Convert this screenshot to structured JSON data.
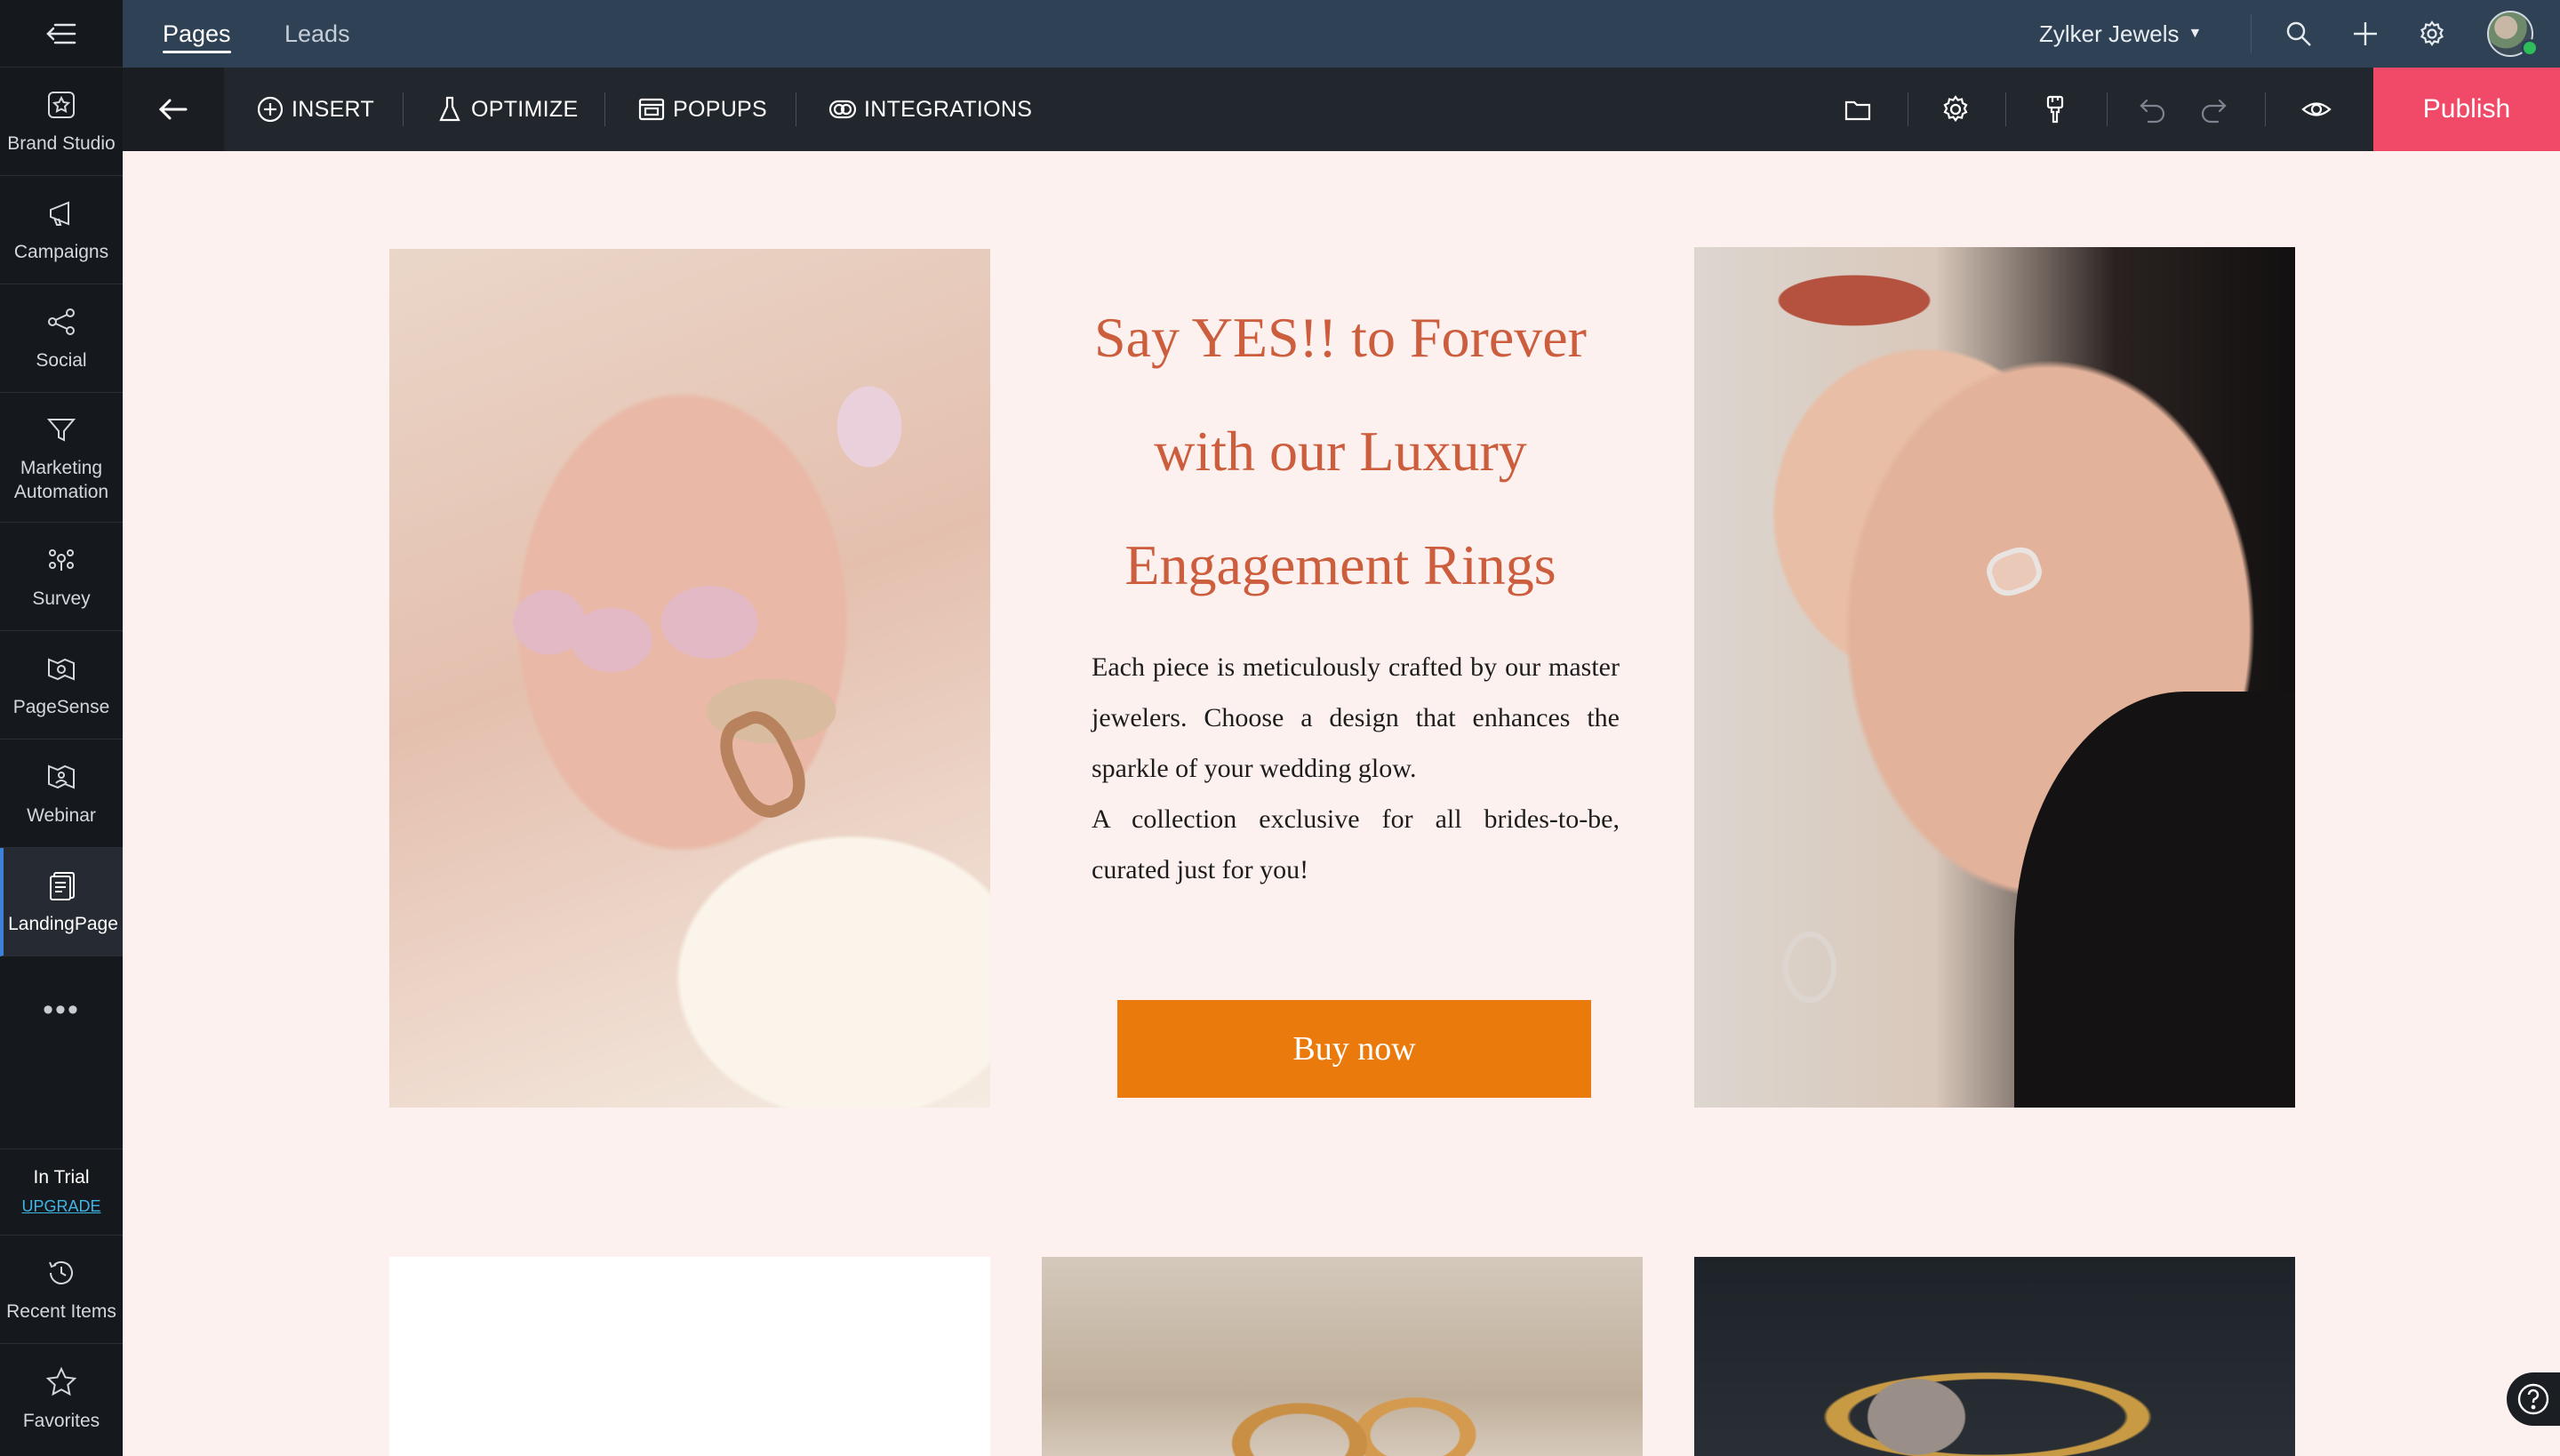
{
  "sidebar": {
    "items": [
      {
        "label": "Brand Studio",
        "icon": "brand-studio-icon"
      },
      {
        "label": "Campaigns",
        "icon": "megaphone-icon"
      },
      {
        "label": "Social",
        "icon": "share-icon"
      },
      {
        "label": "Marketing Automation",
        "icon": "funnel-icon"
      },
      {
        "label": "Survey",
        "icon": "survey-icon"
      },
      {
        "label": "PageSense",
        "icon": "pagesense-icon"
      },
      {
        "label": "Webinar",
        "icon": "webinar-icon"
      },
      {
        "label": "LandingPage",
        "icon": "landing-page-icon",
        "active": true
      }
    ],
    "more": "•••",
    "trial": {
      "status": "In Trial",
      "upgrade": "UPGRADE"
    },
    "recent": "Recent Items",
    "favorites": "Favorites"
  },
  "topbar": {
    "tabs": [
      {
        "label": "Pages",
        "active": true
      },
      {
        "label": "Leads",
        "active": false
      }
    ],
    "org": "Zylker Jewels"
  },
  "toolbar": {
    "insert": "INSERT",
    "optimize": "OPTIMIZE",
    "popups": "POPUPS",
    "integrations": "INTEGRATIONS",
    "publish": "Publish"
  },
  "hero": {
    "title_lines": [
      "Say YES!! to Forever",
      "with our Luxury",
      "Engagement Rings"
    ],
    "body_1": "Each piece is meticulously crafted by our master jewelers. Choose a design that enhances the sparkle of your wedding glow.",
    "body_2": "A collection exclusive for all brides-to-be, curated just for you!",
    "cta": "Buy now"
  },
  "colors": {
    "sidebar_bg": "#15181c",
    "topbar_bg": "#2f4155",
    "toolbar_bg": "#22272e",
    "publish": "#f04a68",
    "canvas_bg": "#fdf1ef",
    "title": "#cc5d3d",
    "cta": "#ea7a0c"
  }
}
